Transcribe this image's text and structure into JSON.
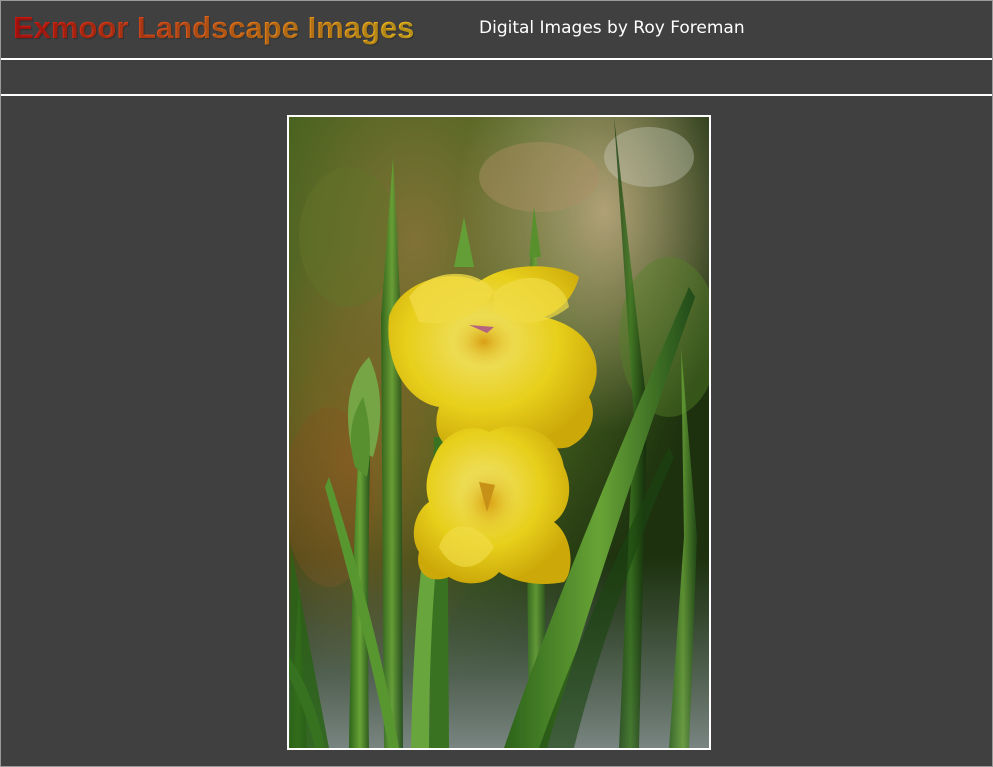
{
  "header": {
    "title": "Exmoor Landscape Images",
    "subtitle": "Digital Images by Roy Foreman"
  },
  "photo": {
    "subject": "yellow-gladiolus-flower"
  },
  "colors": {
    "background": "#404040",
    "divider": "#ffffff",
    "title_gradient_start": "#d01510",
    "title_gradient_end": "#f2c21e",
    "subtitle_text": "#ffffff"
  }
}
